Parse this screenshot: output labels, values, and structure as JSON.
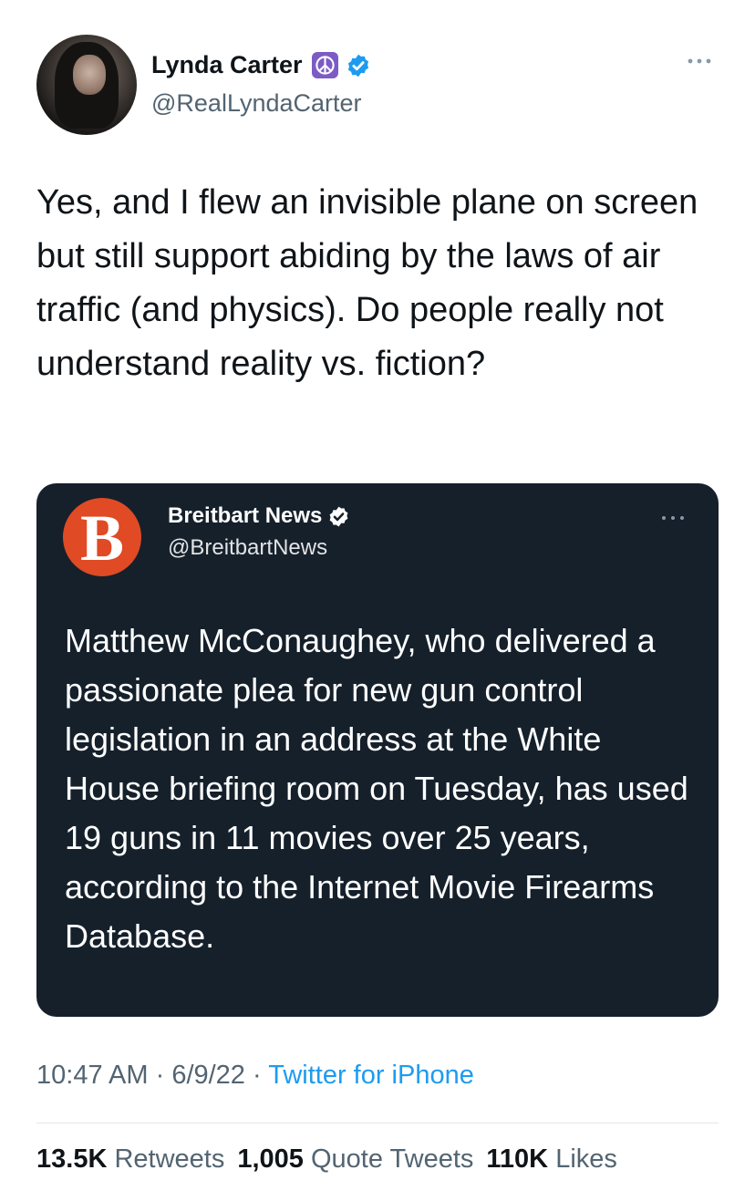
{
  "tweet": {
    "author": {
      "display_name": "Lynda Carter",
      "handle": "@RealLyndaCarter",
      "emoji_icon": "peace-symbol-icon",
      "verified": true
    },
    "text": "Yes, and I flew an invisible plane on screen but still support abiding by the laws of air traffic (and physics). Do people really not understand reality vs. fiction?",
    "quoted": {
      "display_name": "Breitbart News",
      "handle": "@BreitbartNews",
      "avatar_letter": "B",
      "verified": true,
      "text": "Matthew McConaughey, who delivered a passionate plea for new gun control legislation in an address at the White House briefing room on Tuesday, has used 19 guns in 11 movies over 25 years, according to the Internet Movie Firearms Database."
    },
    "meta": {
      "time": "10:47 AM",
      "separator": " · ",
      "date": "6/9/22",
      "source": "Twitter for iPhone"
    },
    "stats": {
      "retweets_count": "13.5K",
      "retweets_label": "Retweets",
      "quotes_count": "1,005",
      "quotes_label": "Quote Tweets",
      "likes_count": "110K",
      "likes_label": "Likes"
    }
  },
  "colors": {
    "accent": "#1d9bf0",
    "quote_background": "#15202b",
    "secondary_text": "#536471",
    "breitbart_brand": "#e04a24"
  }
}
